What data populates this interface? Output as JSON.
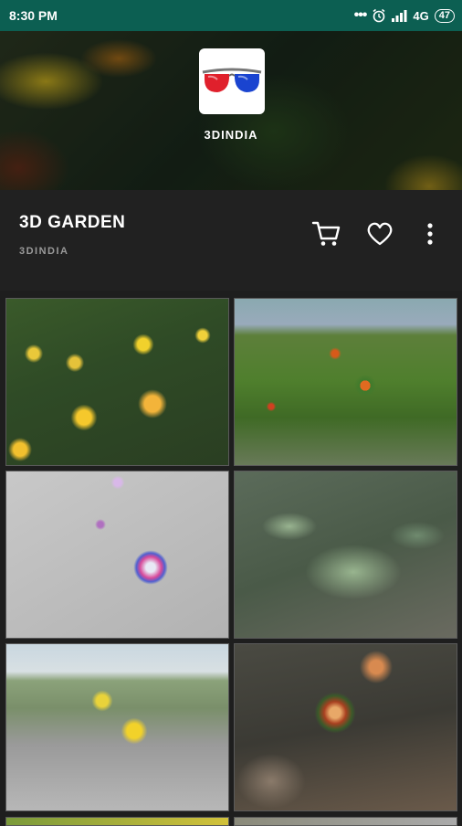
{
  "status_bar": {
    "time": "8:30 PM",
    "network": "4G",
    "battery": "47",
    "icons": [
      "notification-dots-icon",
      "alarm-icon",
      "signal-icon",
      "battery-icon"
    ]
  },
  "header": {
    "app_name": "3DINDIA",
    "app_icon": "anaglyph-3d-glasses-icon"
  },
  "product": {
    "title": "3D GARDEN",
    "publisher": "3DINDIA",
    "actions": [
      "cart-icon",
      "heart-icon",
      "more-vert-icon"
    ]
  },
  "gallery": {
    "tiles": [
      "yellow-flowers",
      "garden-red-flower",
      "pink-blue-flower",
      "green-plant",
      "yellow-flower-wall",
      "potted-succulent"
    ]
  },
  "colors": {
    "status_bar": "#0c5f52",
    "background": "#1e1e1e",
    "section": "#212121"
  }
}
